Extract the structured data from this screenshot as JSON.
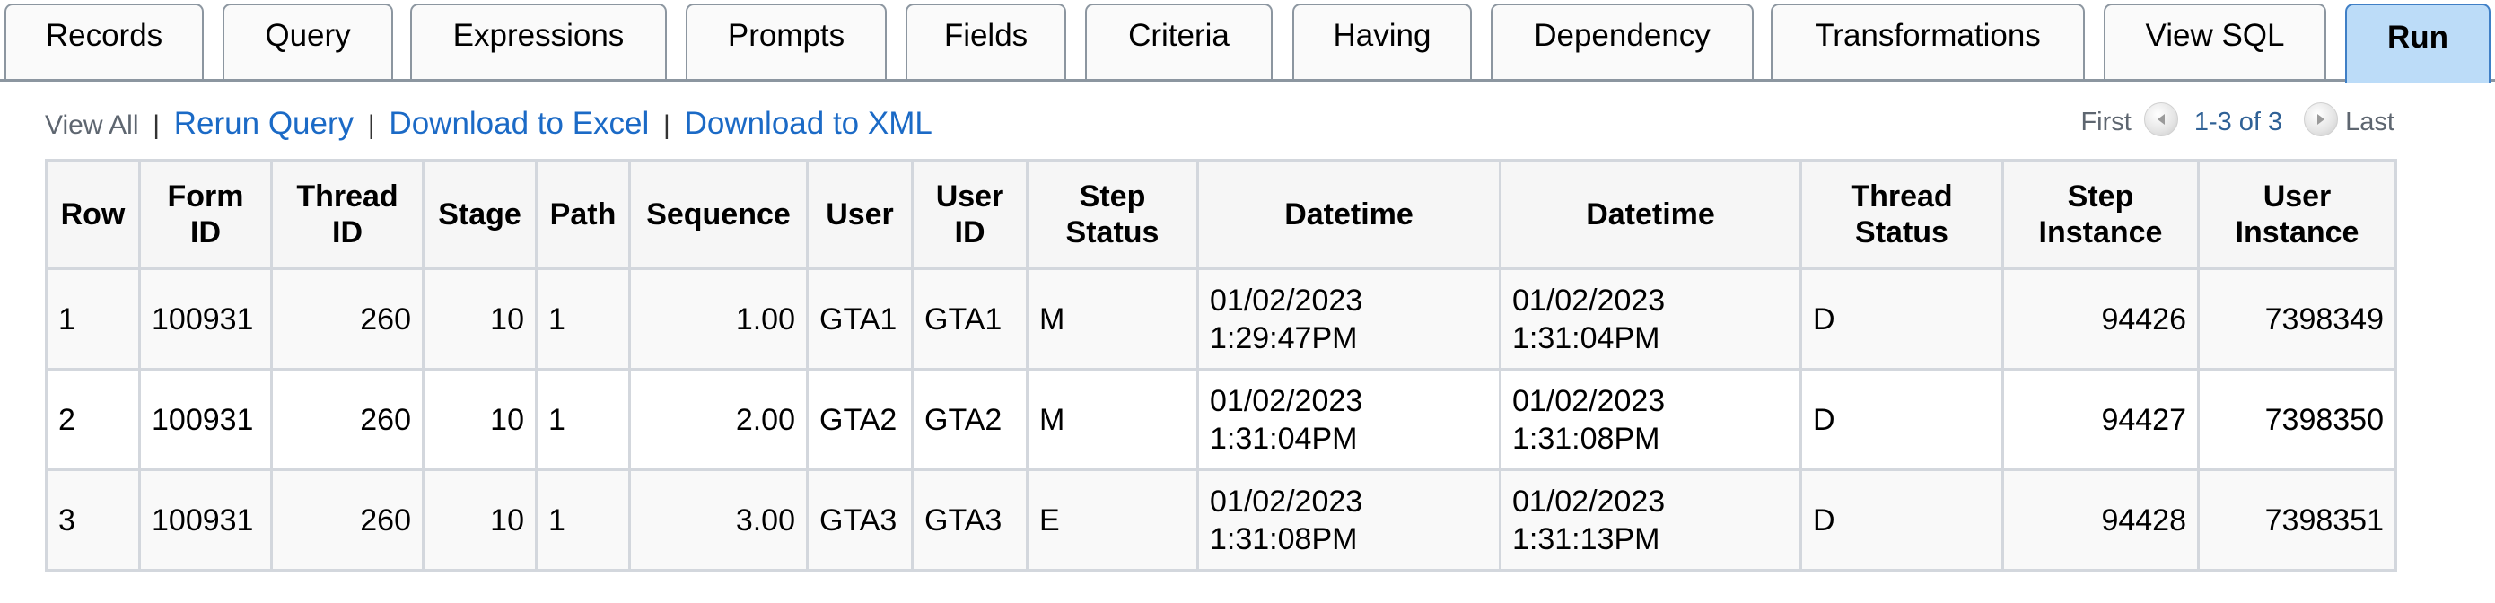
{
  "tabs": [
    {
      "label": "Records",
      "active": false
    },
    {
      "label": "Query",
      "active": false
    },
    {
      "label": "Expressions",
      "active": false
    },
    {
      "label": "Prompts",
      "active": false
    },
    {
      "label": "Fields",
      "active": false
    },
    {
      "label": "Criteria",
      "active": false
    },
    {
      "label": "Having",
      "active": false
    },
    {
      "label": "Dependency",
      "active": false
    },
    {
      "label": "Transformations",
      "active": false
    },
    {
      "label": "View SQL",
      "active": false
    },
    {
      "label": "Run",
      "active": true
    }
  ],
  "toolbar": {
    "view_all": "View All",
    "separator": "|",
    "rerun_query": "Rerun Query",
    "download_excel": "Download to Excel",
    "download_xml": "Download to XML"
  },
  "pager": {
    "first": "First",
    "range": "1-3 of 3",
    "last": "Last",
    "prev_icon": "previous-arrow-icon",
    "next_icon": "next-arrow-icon"
  },
  "table": {
    "headers": [
      "Row",
      "Form ID",
      "Thread ID",
      "Stage",
      "Path",
      "Sequence",
      "User",
      "User ID",
      "Step Status",
      "Datetime",
      "Datetime",
      "Thread Status",
      "Step Instance",
      "User Instance"
    ],
    "rows": [
      [
        "1",
        "100931",
        "260",
        "10",
        "1",
        "1.00",
        "GTA1",
        "GTA1",
        "M",
        "01/02/2023 1:29:47PM",
        "01/02/2023 1:31:04PM",
        "D",
        "94426",
        "7398349"
      ],
      [
        "2",
        "100931",
        "260",
        "10",
        "1",
        "2.00",
        "GTA2",
        "GTA2",
        "M",
        "01/02/2023 1:31:04PM",
        "01/02/2023 1:31:08PM",
        "D",
        "94427",
        "7398350"
      ],
      [
        "3",
        "100931",
        "260",
        "10",
        "1",
        "3.00",
        "GTA3",
        "GTA3",
        "E",
        "01/02/2023 1:31:08PM",
        "01/02/2023 1:31:13PM",
        "D",
        "94428",
        "7398351"
      ]
    ]
  },
  "colors": {
    "active_tab_bg": "#bcdcf8",
    "link": "#1b6ac6",
    "pager_count": "#2f6196"
  }
}
